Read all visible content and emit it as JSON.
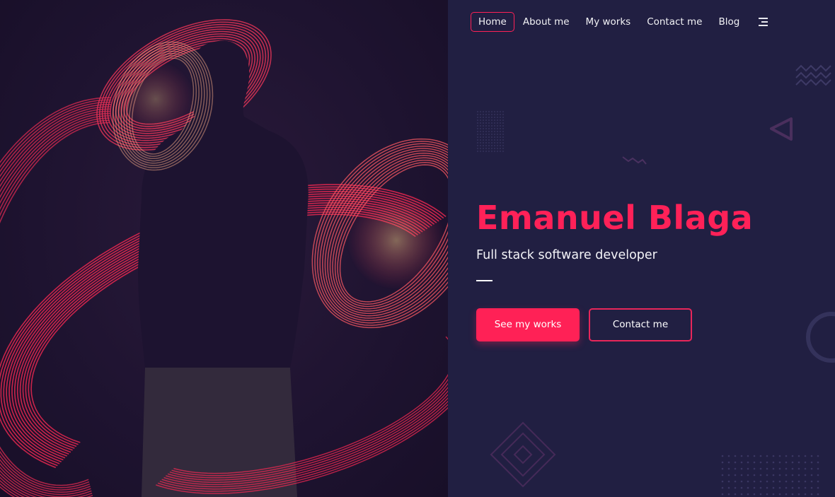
{
  "nav": {
    "items": [
      {
        "label": "Home",
        "active": true
      },
      {
        "label": "About me",
        "active": false
      },
      {
        "label": "My works",
        "active": false
      },
      {
        "label": "Contact me",
        "active": false
      },
      {
        "label": "Blog",
        "active": false
      }
    ],
    "menu_icon": "hamburger-menu-icon"
  },
  "hero": {
    "name": "Emanuel Blaga",
    "subtitle": "Full stack software developer",
    "primary_button": "See my works",
    "secondary_button": "Contact me"
  },
  "colors": {
    "background": "#211f42",
    "accent": "#ff2156",
    "text": "#ffffff"
  }
}
